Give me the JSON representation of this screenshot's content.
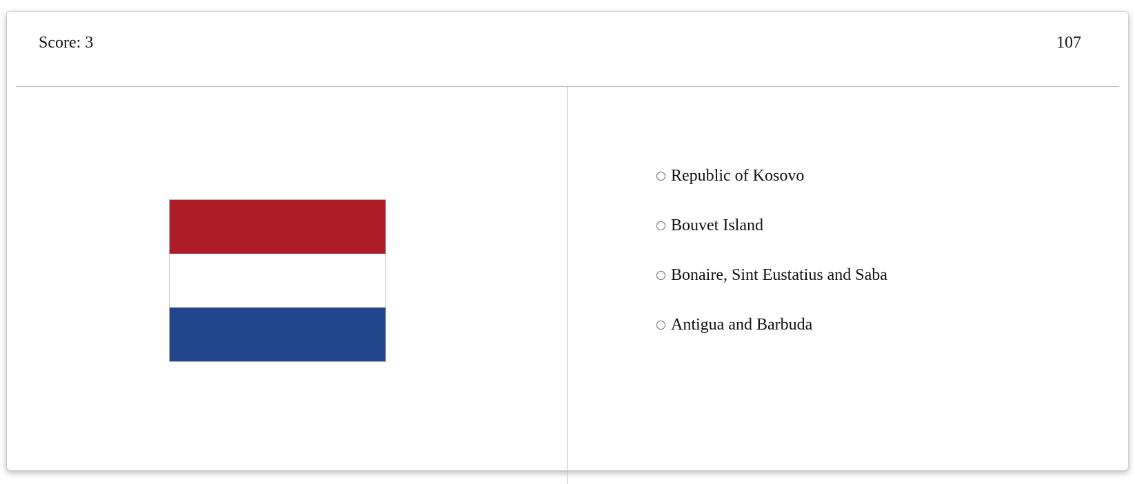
{
  "header": {
    "score_text": "Score: 3",
    "timer_text": "107"
  },
  "flag": {
    "icon": "flag-netherlands-icon",
    "stripes": [
      {
        "name": "top",
        "color": "#AE1C28"
      },
      {
        "name": "middle",
        "color": "#FFFFFF"
      },
      {
        "name": "bottom",
        "color": "#21468B"
      }
    ]
  },
  "options": [
    {
      "label": "Republic of Kosovo",
      "selected": false
    },
    {
      "label": "Bouvet Island",
      "selected": false
    },
    {
      "label": "Bonaire, Sint Eustatius and Saba",
      "selected": false
    },
    {
      "label": "Antigua and Barbuda",
      "selected": false
    }
  ]
}
